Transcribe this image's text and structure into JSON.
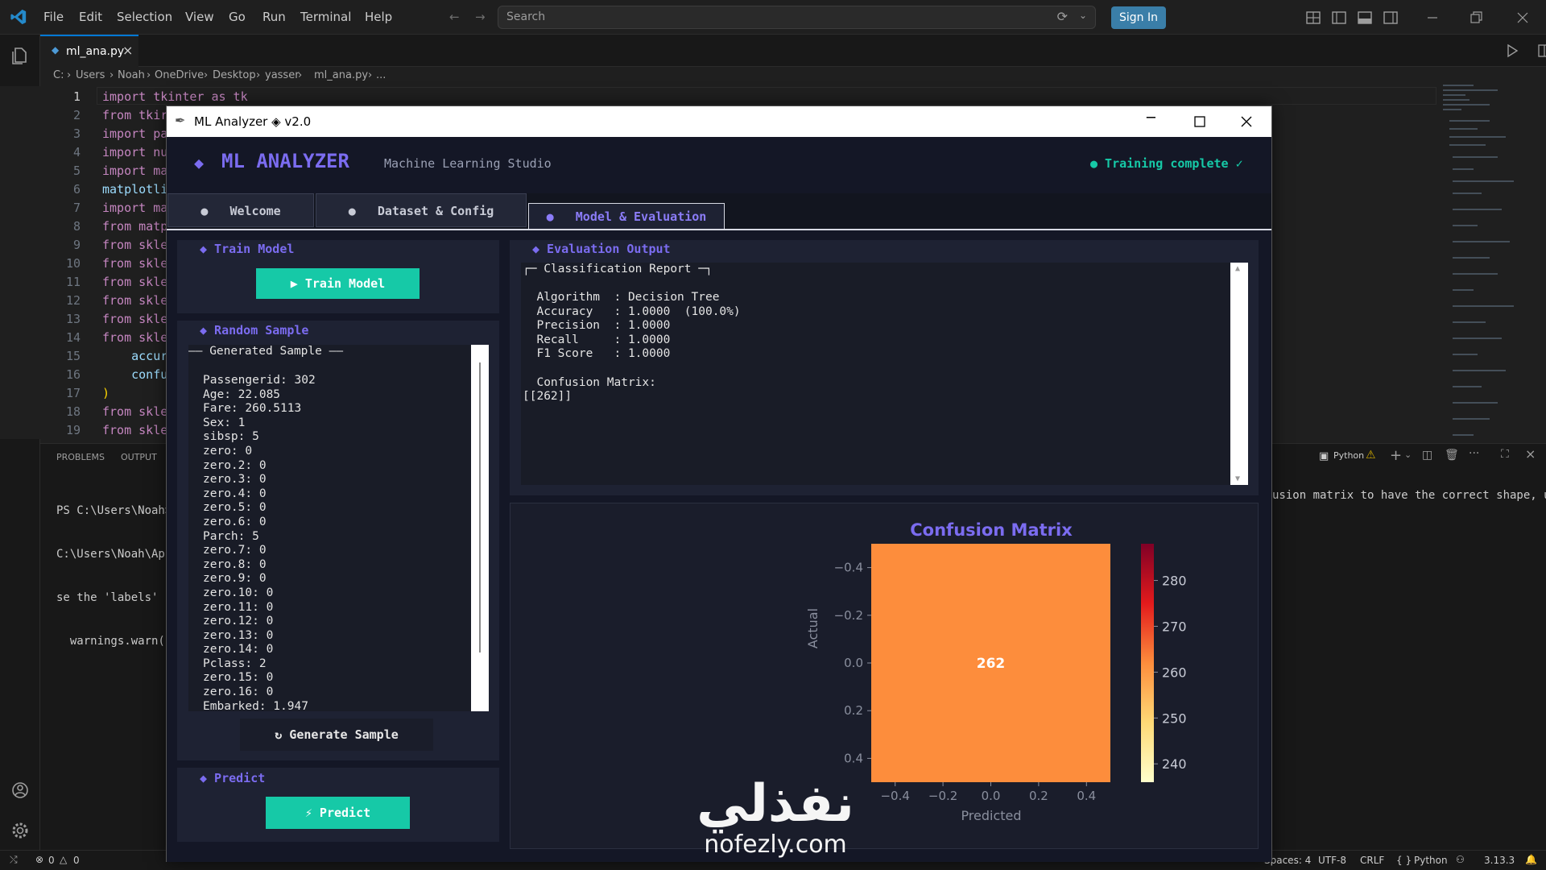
{
  "vscode": {
    "menu": [
      "File",
      "Edit",
      "Selection",
      "View",
      "Go",
      "Run",
      "Terminal",
      "Help"
    ],
    "search_placeholder": "Search",
    "sign_in": "Sign In",
    "tab_name": "ml_ana.py",
    "breadcrumb": [
      "C:",
      "Users",
      "Noah",
      "OneDrive",
      "Desktop",
      "yasser",
      "ml_ana.py",
      "..."
    ],
    "code_lines": [
      {
        "n": "1",
        "t": "import tkinter as tk"
      },
      {
        "n": "2",
        "t": "from tkir"
      },
      {
        "n": "3",
        "t": "import pa"
      },
      {
        "n": "4",
        "t": "import nu"
      },
      {
        "n": "5",
        "t": "import ma"
      },
      {
        "n": "6",
        "t": "matplotli"
      },
      {
        "n": "7",
        "t": "import ma"
      },
      {
        "n": "8",
        "t": "from matp"
      },
      {
        "n": "9",
        "t": "from skle"
      },
      {
        "n": "10",
        "t": "from skle"
      },
      {
        "n": "11",
        "t": "from skle"
      },
      {
        "n": "12",
        "t": "from skle"
      },
      {
        "n": "13",
        "t": "from skle"
      },
      {
        "n": "14",
        "t": "from skle"
      },
      {
        "n": "15",
        "t": "    accur"
      },
      {
        "n": "16",
        "t": "    confu"
      },
      {
        "n": "17",
        "t": ")"
      },
      {
        "n": "18",
        "t": "from skle"
      },
      {
        "n": "19",
        "t": "from skle"
      }
    ],
    "panel_tabs": [
      "PROBLEMS",
      "OUTPUT"
    ],
    "terminal_lines": [
      "PS C:\\Users\\Noah>",
      "C:\\Users\\Noah\\App",
      "se the 'labels' p",
      "  warnings.warn("
    ],
    "terminal_right": "usion matrix to have the correct shape, u",
    "terminal_label": "Python",
    "status": {
      "errors": "0",
      "warnings": "0",
      "spaces": "Spaces: 4",
      "encoding": "UTF-8",
      "eol": "CRLF",
      "language": "Python",
      "version": "3.13.3"
    }
  },
  "app": {
    "window_title": "ML Analyzer ◈ v2.0",
    "logo": "◆",
    "name": "ML ANALYZER",
    "subtitle": "Machine Learning Studio",
    "status": "● Training complete ✓",
    "tabs": [
      "Welcome",
      "Dataset & Config",
      "Model & Evaluation"
    ],
    "active_tab": 2,
    "train_section": "◆ Train Model",
    "train_button": "▶  Train Model",
    "sample_section": "◆ Random Sample",
    "sample_heading": "—— Generated Sample ——",
    "sample_lines": [
      "Passengerid: 302",
      "Age: 22.085",
      "Fare: 260.5113",
      "Sex: 1",
      "sibsp: 5",
      "zero: 0",
      "zero.2: 0",
      "zero.3: 0",
      "zero.4: 0",
      "zero.5: 0",
      "zero.6: 0",
      "Parch: 5",
      "zero.7: 0",
      "zero.8: 0",
      "zero.9: 0",
      "zero.10: 0",
      "zero.11: 0",
      "zero.12: 0",
      "zero.13: 0",
      "zero.14: 0",
      "Pclass: 2",
      "zero.15: 0",
      "zero.16: 0",
      "Embarked: 1.947"
    ],
    "generate_button": "↻  Generate Sample",
    "predict_section": "◆ Predict",
    "predict_button": "⚡  Predict",
    "eval_section": "◆ Evaluation Output",
    "report_heading": "┌─ Classification Report ─┐",
    "report_lines": [
      "  Algorithm  : Decision Tree",
      "  Accuracy   : 1.0000  (100.0%)",
      "  Precision  : 1.0000",
      "  Recall     : 1.0000",
      "  F1 Score   : 1.0000",
      "",
      "  Confusion Matrix:",
      "[[262]]"
    ]
  },
  "chart_data": {
    "type": "heatmap",
    "title": "Confusion Matrix",
    "xlabel": "Predicted",
    "ylabel": "Actual",
    "values": [
      [
        262
      ]
    ],
    "x_ticks": [
      "−0.4",
      "−0.2",
      "0.0",
      "0.2",
      "0.4"
    ],
    "y_ticks": [
      "−0.4",
      "−0.2",
      "0.0",
      "0.2",
      "0.4"
    ],
    "colorbar_ticks": [
      "280",
      "270",
      "260",
      "250",
      "240"
    ],
    "colorbar_range": [
      236,
      288
    ],
    "colormap": "YlOrRd",
    "cell_color": "#fd8d3c",
    "title_color": "#7b6cf0"
  },
  "watermark": {
    "arabic": "نفذلي",
    "latin": "nofezly.com"
  }
}
